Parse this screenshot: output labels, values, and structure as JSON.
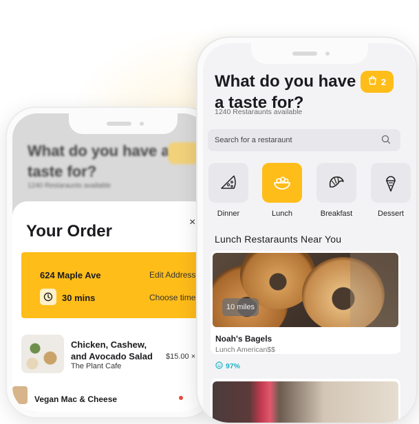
{
  "back_phone": {
    "blurred_title": "What do you have a taste for?",
    "blurred_subtitle": "1240 Restaraunts available",
    "order": {
      "title": "Your Order",
      "close_glyph": "×",
      "address": "624 Maple Ave",
      "edit_address": "Edit Address",
      "time": "30 mins",
      "choose_time": "Choose time",
      "items": [
        {
          "name": "Chicken, Cashew, and Avocado Salad",
          "restaurant": "The Plant Cafe",
          "price": "$15.00 ×"
        },
        {
          "name": "Vegan Mac & Cheese"
        }
      ]
    }
  },
  "front_phone": {
    "title": "What do you have a taste for?",
    "subtitle": "1240 Restaraunts available",
    "cart_count": "2",
    "search": {
      "placeholder": "Search for a restaraunt"
    },
    "categories": [
      {
        "label": "Dinner",
        "icon": "pizza-icon",
        "active": false
      },
      {
        "label": "Lunch",
        "icon": "bowl-icon",
        "active": true
      },
      {
        "label": "Breakfast",
        "icon": "croissant-icon",
        "active": false
      },
      {
        "label": "Dessert",
        "icon": "ice-cream-icon",
        "active": false
      }
    ],
    "section_title": "Lunch Restaraunts Near You",
    "restaurants": [
      {
        "distance": "10 miles",
        "name": "Noah's Bagels",
        "type": "Lunch American$$",
        "rating": "97%"
      }
    ]
  },
  "colors": {
    "accent": "#ffbd1a",
    "rating": "#19b3c4",
    "background": "#f3f3f5"
  }
}
